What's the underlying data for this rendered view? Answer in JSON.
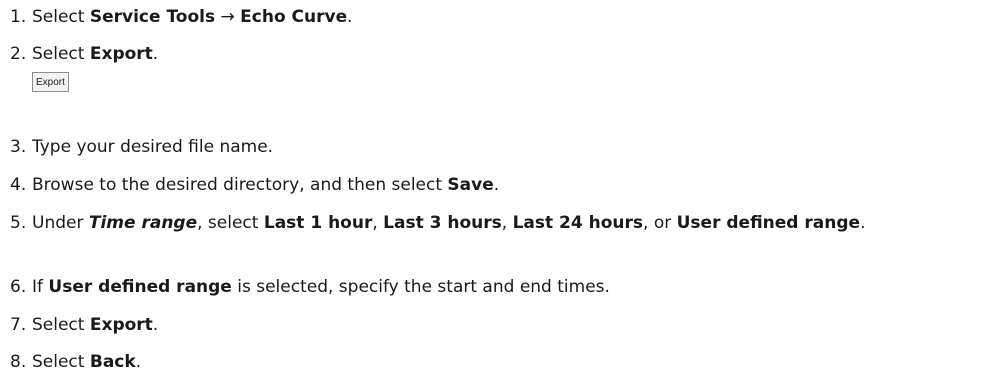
{
  "steps": [
    {
      "number": "1.",
      "parts": [
        {
          "text": "Select ",
          "style": "normal"
        },
        {
          "text": "Service Tools",
          "style": "bold"
        },
        {
          "text": " → ",
          "style": "normal"
        },
        {
          "text": "Echo Curve",
          "style": "bold"
        },
        {
          "text": ".",
          "style": "normal"
        }
      ]
    },
    {
      "number": "2.",
      "parts": [
        {
          "text": "Select ",
          "style": "normal"
        },
        {
          "text": "Export",
          "style": "bold"
        },
        {
          "text": ".",
          "style": "normal"
        }
      ],
      "image_label": "Export"
    },
    {
      "number": "3.",
      "parts": [
        {
          "text": "Type your desired file name.",
          "style": "normal"
        }
      ]
    },
    {
      "number": "4.",
      "parts": [
        {
          "text": "Browse to the desired directory, and then select ",
          "style": "normal"
        },
        {
          "text": "Save",
          "style": "bold"
        },
        {
          "text": ".",
          "style": "normal"
        }
      ]
    },
    {
      "number": "5.",
      "parts": [
        {
          "text": "Under ",
          "style": "normal"
        },
        {
          "text": "Time range",
          "style": "bold-italic"
        },
        {
          "text": ", select ",
          "style": "normal"
        },
        {
          "text": "Last 1 hour",
          "style": "bold"
        },
        {
          "text": ", ",
          "style": "normal"
        },
        {
          "text": "Last 3 hours",
          "style": "bold"
        },
        {
          "text": ", ",
          "style": "normal"
        },
        {
          "text": "Last 24 hours",
          "style": "bold"
        },
        {
          "text": ", or ",
          "style": "normal"
        },
        {
          "text": "User defined range",
          "style": "bold"
        },
        {
          "text": ".",
          "style": "normal"
        }
      ]
    },
    {
      "number": "6.",
      "parts": [
        {
          "text": "If ",
          "style": "normal"
        },
        {
          "text": "User defined range",
          "style": "bold"
        },
        {
          "text": " is selected, specify the start and end times.",
          "style": "normal"
        }
      ]
    },
    {
      "number": "7.",
      "parts": [
        {
          "text": "Select ",
          "style": "normal"
        },
        {
          "text": "Export",
          "style": "bold"
        },
        {
          "text": ".",
          "style": "normal"
        }
      ]
    },
    {
      "number": "8.",
      "parts": [
        {
          "text": "Select ",
          "style": "normal"
        },
        {
          "text": "Back",
          "style": "bold"
        },
        {
          "text": ".",
          "style": "normal"
        }
      ]
    }
  ]
}
